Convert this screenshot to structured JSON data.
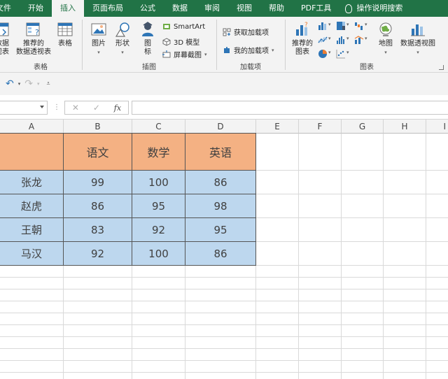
{
  "tabs": [
    {
      "label": "文件"
    },
    {
      "label": "开始"
    },
    {
      "label": "插入"
    },
    {
      "label": "页面布局"
    },
    {
      "label": "公式"
    },
    {
      "label": "数据"
    },
    {
      "label": "审阅"
    },
    {
      "label": "视图"
    },
    {
      "label": "帮助"
    },
    {
      "label": "PDF工具"
    }
  ],
  "tell_me": "操作说明搜索",
  "ribbon": {
    "tables_group": {
      "pivot_partial_l1": "数据",
      "pivot_partial_l2": "视表",
      "recommended_pivot_l1": "推荐的",
      "recommended_pivot_l2": "数据透视表",
      "table": "表格",
      "label": "表格"
    },
    "illustrations_group": {
      "pictures": "图片",
      "shapes": "形状",
      "icons_l1": "图",
      "icons_l2": "标",
      "smartart": "SmartArt",
      "model3d": "3D 模型",
      "screenshot": "屏幕截图",
      "label": "插图"
    },
    "addins_group": {
      "get_addins": "获取加载项",
      "my_addins": "我的加载项",
      "label": "加载项"
    },
    "charts_group": {
      "recommended_l1": "推荐的",
      "recommended_l2": "图表",
      "maps": "地图",
      "pivotchart": "数据透视图",
      "label": "图表"
    }
  },
  "formula_bar": {
    "name_box": "",
    "cancel": "✕",
    "enter": "✓",
    "fx": "fx",
    "formula": ""
  },
  "columns": [
    "A",
    "B",
    "C",
    "D",
    "E",
    "F",
    "G",
    "H",
    "I"
  ],
  "table": {
    "header": [
      "",
      "语文",
      "数学",
      "英语"
    ],
    "rows": [
      [
        "张龙",
        "99",
        "100",
        "86"
      ],
      [
        "赵虎",
        "86",
        "95",
        "98"
      ],
      [
        "王朝",
        "83",
        "92",
        "95"
      ],
      [
        "马汉",
        "92",
        "100",
        "86"
      ]
    ]
  },
  "colors": {
    "ribbon_green": "#217346",
    "header_fill": "#f4b183",
    "body_fill": "#bdd7ee"
  }
}
